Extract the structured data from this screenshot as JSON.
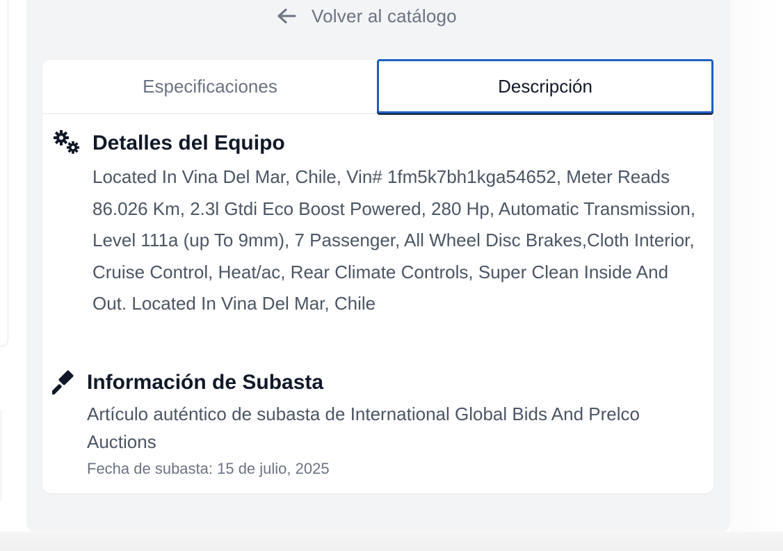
{
  "header": {
    "back_label": "Volver al catálogo"
  },
  "tabs": [
    {
      "label": "Especificaciones",
      "active": false
    },
    {
      "label": "Descripción",
      "active": true
    }
  ],
  "equipment": {
    "icon": "gears-icon",
    "title": "Detalles del Equipo",
    "description": "Located In Vina Del Mar, Chile, Vin# 1fm5k7bh1kga54652, Meter Reads 86.026 Km, 2.3l Gtdi Eco Boost Powered, 280 Hp, Automatic Transmission, Level 111a (up To 9mm), 7 Passenger, All Wheel Disc Brakes,Cloth Interior, Cruise Control, Heat/ac, Rear Climate Controls, Super Clean Inside And Out. Located In Vina Del Mar, Chile"
  },
  "auction": {
    "icon": "gavel-icon",
    "title": "Información de Subasta",
    "description": "Artículo auténtico de subasta de International Global Bids And Prelco Auctions",
    "date": "Fecha de subasta: 15 de julio, 2025"
  },
  "colors": {
    "active_tab_border": "#1f5fbf",
    "panel_bg": "#f3f4f6",
    "text_primary": "#111827",
    "text_secondary": "#4b5563",
    "text_muted": "#6b7280"
  }
}
